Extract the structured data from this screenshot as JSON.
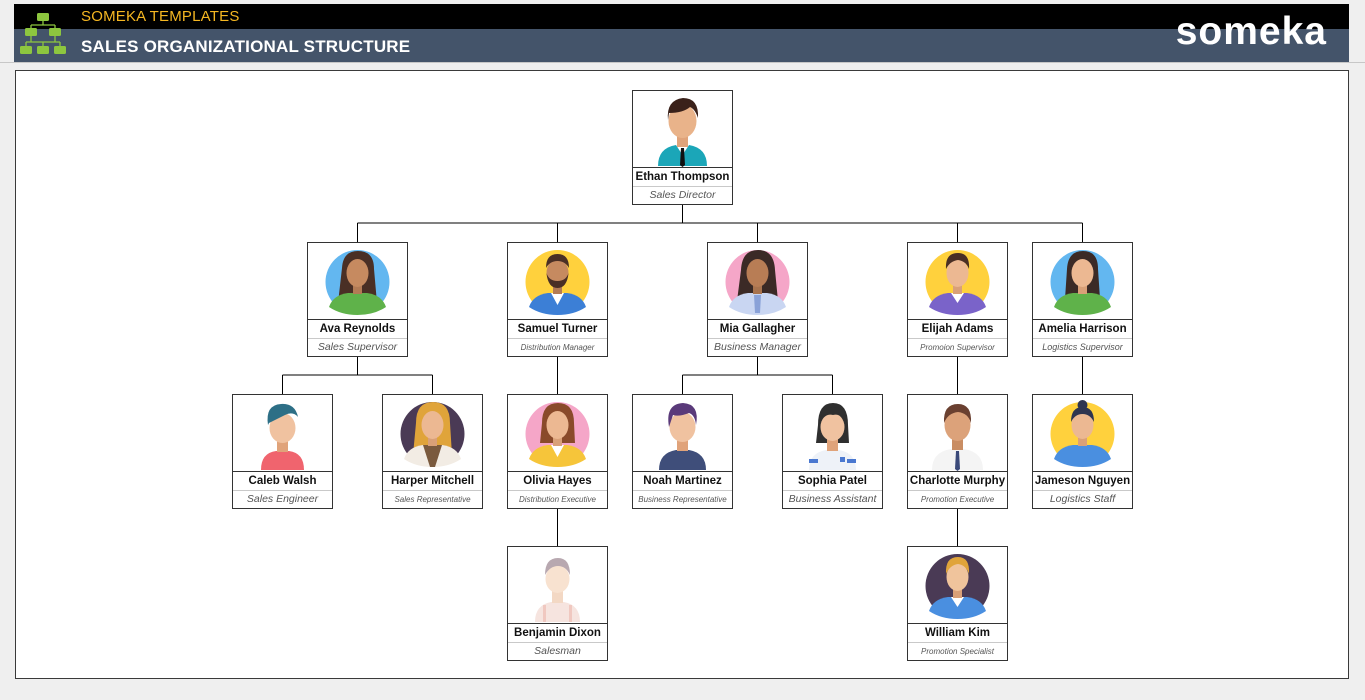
{
  "header": {
    "brand": "SOMEKA TEMPLATES",
    "title": "SALES ORGANIZATIONAL STRUCTURE",
    "wordmark": "someka"
  },
  "colors": {
    "top_bar": "#000000",
    "title_bar": "#44546a",
    "brand_text": "#f5b722",
    "logo_green": "#8dc63f",
    "connector": "#000000"
  },
  "org": {
    "director": {
      "name": "Ethan Thompson",
      "role": "Sales Director",
      "avatar": "man-teal-shirt-avatar"
    },
    "managers": [
      {
        "name": "Ava Reynolds",
        "role": "Sales Supervisor",
        "avatar": "woman-blue-circle-avatar"
      },
      {
        "name": "Samuel Turner",
        "role": "Distribution Manager",
        "avatar": "man-yellow-circle-avatar"
      },
      {
        "name": "Mia Gallagher",
        "role": "Business Manager",
        "avatar": "woman-pink-circle-avatar"
      },
      {
        "name": "Elijah Adams",
        "role": "Promoion Supervisor",
        "avatar": "man-yellow-circle-purple-shirt-avatar"
      },
      {
        "name": "Amelia Harrison",
        "role": "Logistics Supervisor",
        "avatar": "woman-blue-circle-green-shirt-avatar"
      }
    ],
    "staff": [
      {
        "name": "Caleb Walsh",
        "role": "Sales Engineer",
        "avatar": "boy-red-shirt-avatar"
      },
      {
        "name": "Harper Mitchell",
        "role": "Sales Representative",
        "avatar": "woman-dark-circle-avatar"
      },
      {
        "name": "Olivia Hayes",
        "role": "Distribution Executive",
        "avatar": "woman-pink-circle-yellow-avatar"
      },
      {
        "name": "Noah Martinez",
        "role": "Business Representative",
        "avatar": "man-purple-hair-avatar"
      },
      {
        "name": "Sophia Patel",
        "role": "Business Assistant",
        "avatar": "woman-nurse-avatar"
      },
      {
        "name": "Charlotte Murphy",
        "role": "Promotion Executive",
        "avatar": "man-white-shirt-tie-avatar"
      },
      {
        "name": "Jameson Nguyen",
        "role": "Logistics Staff",
        "avatar": "woman-yellow-circle-blue-avatar"
      },
      {
        "name": "Benjamin Dixon",
        "role": "Salesman",
        "avatar": "man-faded-avatar"
      },
      {
        "name": "William Kim",
        "role": "Promotion Specialist",
        "avatar": "man-dark-circle-blue-avatar"
      }
    ]
  }
}
